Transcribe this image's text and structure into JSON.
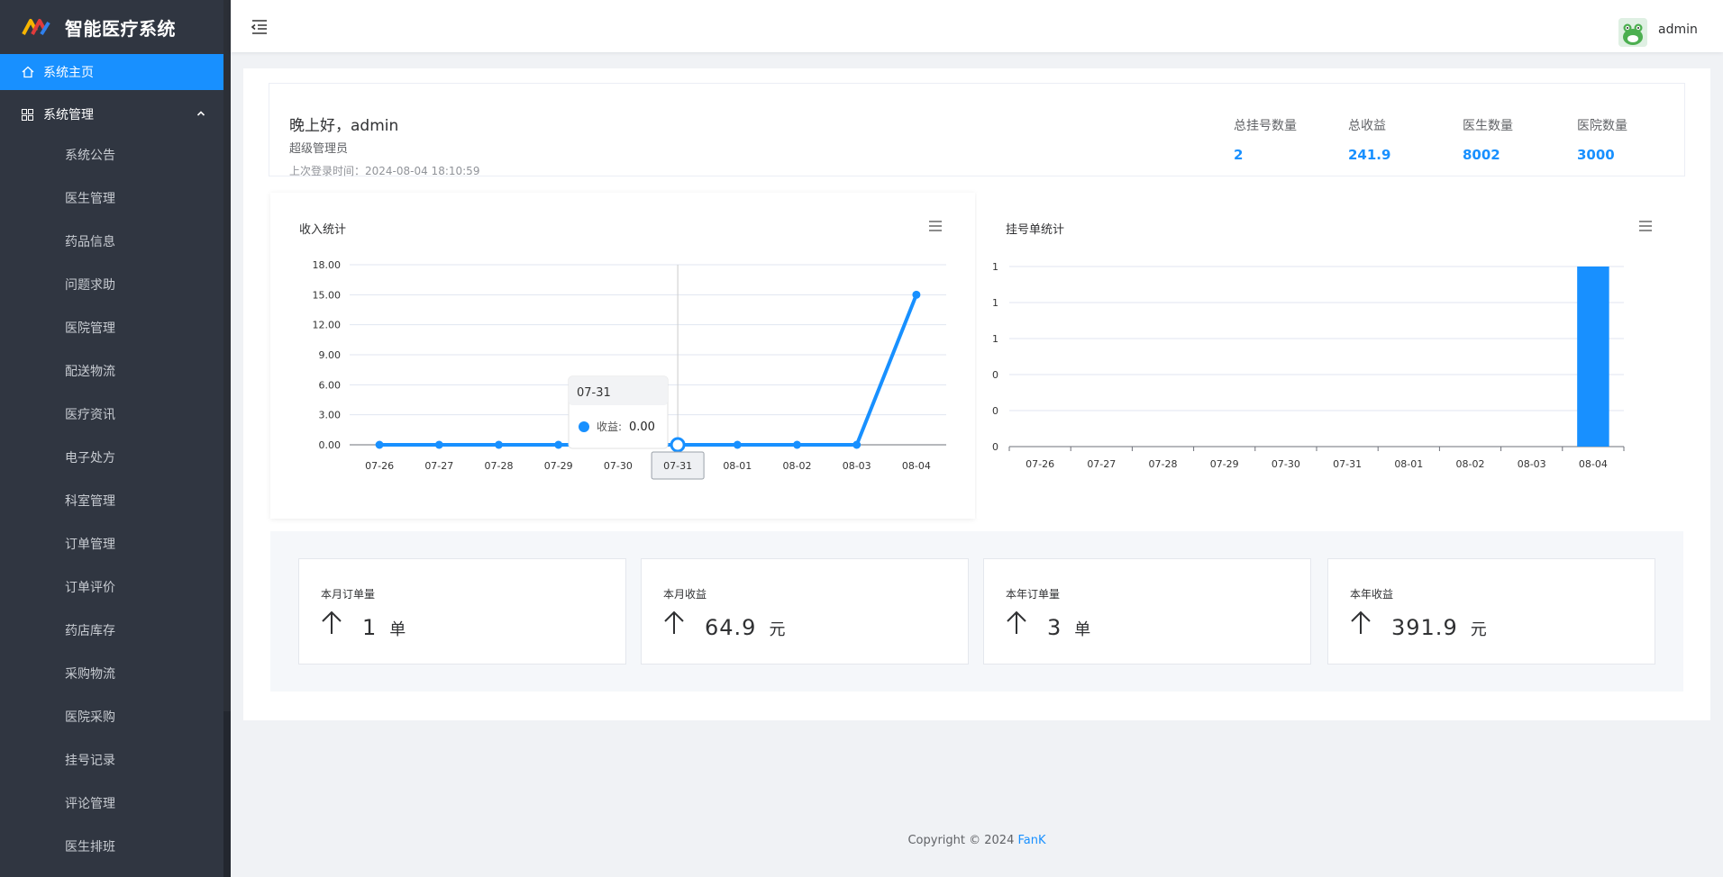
{
  "app": {
    "title": "智能医疗系统"
  },
  "sidebar": {
    "home": "系统主页",
    "group": "系统管理",
    "items": [
      "系统公告",
      "医生管理",
      "药品信息",
      "问题求助",
      "医院管理",
      "配送物流",
      "医疗资讯",
      "电子处方",
      "科室管理",
      "订单管理",
      "订单评价",
      "药店库存",
      "采购物流",
      "医院采购",
      "挂号记录",
      "评论管理",
      "医生排班"
    ]
  },
  "header": {
    "user": "admin"
  },
  "welcome": {
    "greeting": "晚上好，admin",
    "role": "超级管理员",
    "last_login": "上次登录时间：2024-08-04 18:10:59",
    "stats": [
      {
        "label": "总挂号数量",
        "value": "2"
      },
      {
        "label": "总收益",
        "value": "241.9"
      },
      {
        "label": "医生数量",
        "value": "8002"
      },
      {
        "label": "医院数量",
        "value": "3000"
      }
    ]
  },
  "chart_data": [
    {
      "type": "line",
      "title": "收入统计",
      "categories": [
        "07-26",
        "07-27",
        "07-28",
        "07-29",
        "07-30",
        "07-31",
        "08-01",
        "08-02",
        "08-03",
        "08-04"
      ],
      "y_ticks": [
        "0.00",
        "3.00",
        "6.00",
        "9.00",
        "12.00",
        "15.00",
        "18.00"
      ],
      "ylim": [
        0,
        18
      ],
      "series": [
        {
          "values": [
            0,
            0,
            0,
            0,
            0,
            0,
            0,
            0,
            0,
            15
          ]
        }
      ],
      "tooltip": {
        "category": "07-31",
        "label": "收益:",
        "value": "0.00"
      },
      "highlight": "07-31",
      "color": "#1890ff"
    },
    {
      "type": "bar",
      "title": "挂号单统计",
      "categories": [
        "07-26",
        "07-27",
        "07-28",
        "07-29",
        "07-30",
        "07-31",
        "08-01",
        "08-02",
        "08-03",
        "08-04"
      ],
      "y_ticks": [
        "0",
        "0",
        "0",
        "1",
        "1",
        "1"
      ],
      "ylim": [
        0,
        1
      ],
      "series": [
        {
          "values": [
            0,
            0,
            0,
            0,
            0,
            0,
            0,
            0,
            0,
            1
          ]
        }
      ],
      "color": "#1890ff"
    }
  ],
  "summary": [
    {
      "label": "本月订单量",
      "value": "1",
      "unit": "单"
    },
    {
      "label": "本月收益",
      "value": "64.9",
      "unit": "元"
    },
    {
      "label": "本年订单量",
      "value": "3",
      "unit": "单"
    },
    {
      "label": "本年收益",
      "value": "391.9",
      "unit": "元"
    }
  ],
  "footer": {
    "text": "Copyright © 2024",
    "author": "FanK"
  }
}
